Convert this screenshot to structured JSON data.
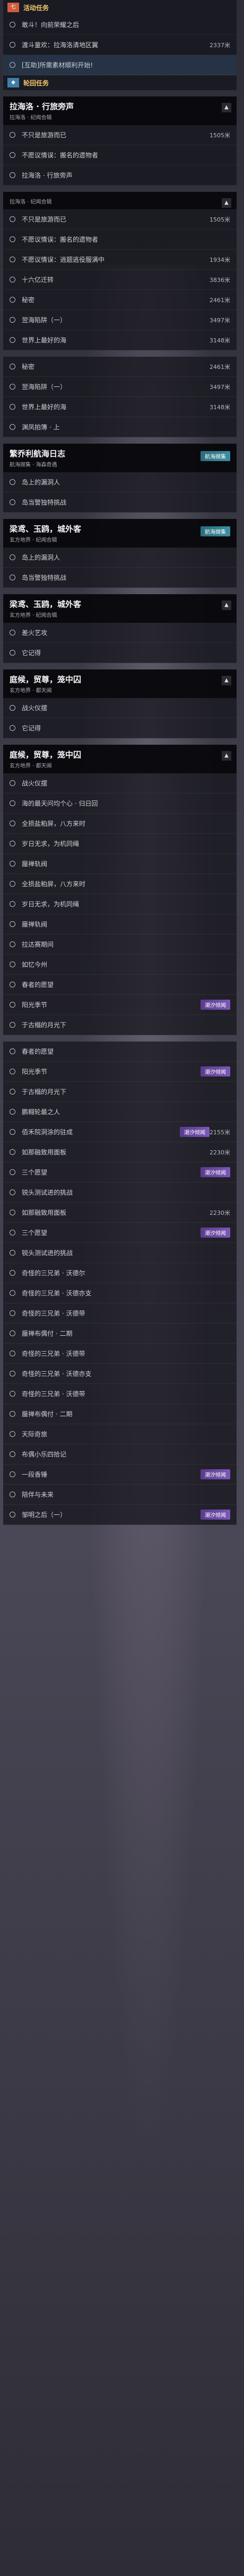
{
  "event_category": {
    "tag": "七",
    "label": "活动任务"
  },
  "event_quests": [
    {
      "name": "敢斗！向前荣耀之后",
      "dist": ""
    },
    {
      "name": "渡斗童欢：拉海洛清地区翼",
      "dist": "2337米"
    }
  ],
  "notice": {
    "name": "[互助]所需素材顺利开始!"
  },
  "side_category": {
    "tag": "",
    "label": "轮回任务"
  },
  "sections": [
    {
      "title": "拉海洛 · 行旅旁声",
      "sub": "拉海洛 · 纪闻合辑",
      "badge": "",
      "quests": [
        {
          "name": "不只是旅游而已",
          "dist": "1505米"
        },
        {
          "name": "不愿议情误：搬名的遗物者",
          "dist": ""
        },
        {
          "name": "拉海洛 · 行旅旁声",
          "dist": ""
        }
      ]
    },
    {
      "title": "",
      "sub": "拉海洛 · 纪闻合辑",
      "badge": "",
      "quests": [
        {
          "name": "不只是旅游而已",
          "dist": "1505米"
        },
        {
          "name": "不愿议情误：搬名的遗物者",
          "dist": ""
        },
        {
          "name": "不愿议情误：逍题逃役服满中",
          "dist": "1934米"
        },
        {
          "name": "十六亿迁转",
          "dist": "3836米"
        },
        {
          "name": "秘密",
          "dist": "2461米"
        },
        {
          "name": "翌海陷阱（一）",
          "dist": "3497米"
        },
        {
          "name": "世界上最好的海",
          "dist": "3148米"
        }
      ]
    },
    {
      "title": "",
      "sub": "",
      "badge": "",
      "quests": [
        {
          "name": "秘密",
          "dist": "2461米"
        },
        {
          "name": "翌海陷阱（一）",
          "dist": "3497米"
        },
        {
          "name": "世界上最好的海",
          "dist": "3148米"
        },
        {
          "name": "渊凤拍簿 · 上",
          "dist": ""
        }
      ]
    },
    {
      "title": "繁乔利航海日志",
      "sub": "航海撷集 · 海森奇遇",
      "badge": "航海撷集",
      "quests": [
        {
          "name": "岛上的漏洞人",
          "dist": ""
        },
        {
          "name": "岛当警独特挑战",
          "dist": ""
        }
      ]
    },
    {
      "title": "梁鸢、玉鸥，城外客",
      "sub": "玄方地界 · 纪闻合辑",
      "badge": "航海撷集",
      "quests": [
        {
          "name": "岛上的漏洞人",
          "dist": ""
        },
        {
          "name": "岛当警独特挑战",
          "dist": ""
        }
      ]
    },
    {
      "title": "梁鸢、玉鸥，城外客",
      "sub": "玄方地界 · 纪闻合辑",
      "badge": "",
      "quests": [
        {
          "name": "差火艺攻",
          "dist": ""
        },
        {
          "name": "它记得",
          "dist": ""
        }
      ]
    },
    {
      "title": "庭候，贸尊，笼中囚",
      "sub": "玄方地界 · 都天闽",
      "badge": "",
      "quests": [
        {
          "name": "战火仪摆",
          "dist": ""
        },
        {
          "name": "它记得",
          "dist": ""
        }
      ]
    },
    {
      "title": "庭候，贸尊，笼中囚",
      "sub": "玄方地界 · 都天闽",
      "badge": "",
      "quests": [
        {
          "name": "战火仪摆",
          "dist": ""
        },
        {
          "name": "海的最天问均个心 · 归日回",
          "dist": ""
        },
        {
          "name": "全损盐粕屏，八方来时",
          "dist": ""
        },
        {
          "name": "岁日无求，为机同绳",
          "dist": ""
        },
        {
          "name": "蜃禅轨阀",
          "dist": ""
        },
        {
          "name": "全损盐粕屏，八方来时",
          "dist": ""
        },
        {
          "name": "岁日无求，为机同绳",
          "dist": ""
        },
        {
          "name": "蜃禅轨阀",
          "dist": ""
        },
        {
          "name": "拉达赛期间",
          "dist": ""
        },
        {
          "name": "如忆今州",
          "dist": ""
        },
        {
          "name": "春者的愿望",
          "dist": ""
        },
        {
          "name": "阳光季节",
          "dist": "",
          "badge": "潮汐倾闻"
        },
        {
          "name": "于古榻的月光下",
          "dist": ""
        }
      ]
    },
    {
      "title": "",
      "sub": "",
      "badge": "",
      "quests": [
        {
          "name": "春者的愿望",
          "dist": ""
        },
        {
          "name": "阳光季节",
          "dist": "",
          "badge": "潮汐倾闻"
        },
        {
          "name": "于古榻的月光下",
          "dist": ""
        },
        {
          "name": "鹏翱轮最之人",
          "dist": ""
        },
        {
          "name": "佰禾院洞涂的驻成",
          "dist": "2155米",
          "badge": "潮汐倾闻"
        },
        {
          "name": "如那融致用面板",
          "dist": "2230米"
        },
        {
          "name": "三个愿望",
          "dist": "",
          "badge": "潮汐倾闻"
        },
        {
          "name": "锐头测试进的挑战",
          "dist": ""
        },
        {
          "name": "如那融致用面板",
          "dist": "2230米"
        },
        {
          "name": "三个愿望",
          "dist": "",
          "badge": "潮汐倾闻"
        },
        {
          "name": "锐头测试进的挑战",
          "dist": ""
        },
        {
          "name": "奇怪的三兄弟 · 沃德尔",
          "dist": ""
        },
        {
          "name": "奇怪的三兄弟 · 沃德亦支",
          "dist": ""
        },
        {
          "name": "奇怪的三兄弟 · 沃德带",
          "dist": ""
        },
        {
          "name": "蜃禅布偶付 · 二期",
          "dist": ""
        },
        {
          "name": "奇怪的三兄弟 · 沃德带",
          "dist": ""
        },
        {
          "name": "奇怪的三兄弟 · 沃德亦支",
          "dist": ""
        },
        {
          "name": "奇怪的三兄弟 · 沃德带",
          "dist": ""
        },
        {
          "name": "蜃禅布偶付 · 二期",
          "dist": ""
        },
        {
          "name": "天际奇旅",
          "dist": ""
        },
        {
          "name": "布偶小乐四拾记",
          "dist": ""
        },
        {
          "name": "一段香锤",
          "dist": "",
          "badge": "潮汐倾闻"
        },
        {
          "name": "陪伴与未来",
          "dist": ""
        },
        {
          "name": "邹明之后（一）",
          "dist": "",
          "badge": "潮汐倾闻"
        }
      ]
    }
  ]
}
